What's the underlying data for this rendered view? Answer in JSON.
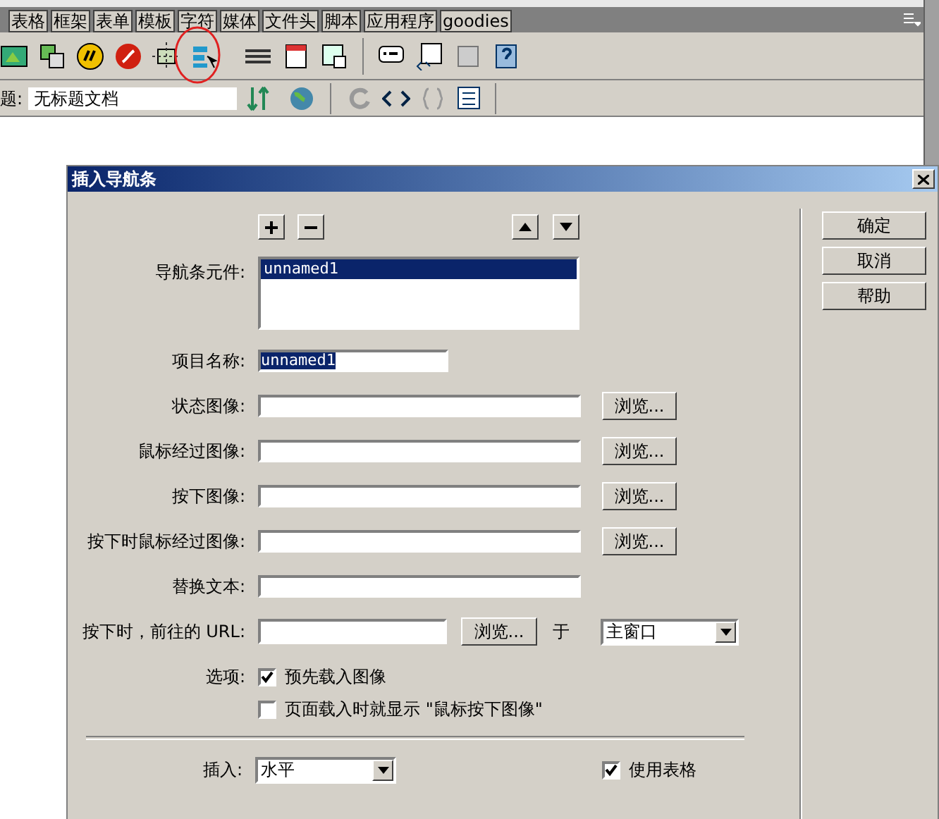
{
  "insert_bar": {
    "tabs": [
      {
        "label": "表格"
      },
      {
        "label": "框架"
      },
      {
        "label": "表单"
      },
      {
        "label": "模板"
      },
      {
        "label": "字符"
      },
      {
        "label": "媒体"
      },
      {
        "label": "文件头"
      },
      {
        "label": "脚本"
      },
      {
        "label": "应用程序"
      },
      {
        "label": "goodies"
      }
    ]
  },
  "document_toolbar": {
    "title_label": "题:",
    "title_value": "无标题文档"
  },
  "dialog": {
    "title": "插入导航条",
    "elements": {
      "label": "导航条元件:",
      "items": [
        {
          "label": "unnamed1",
          "selected": true
        }
      ]
    },
    "item_name": {
      "label": "项目名称:",
      "value": "unnamed1",
      "text_selected": true
    },
    "image_fields": [
      {
        "label": "状态图像:",
        "browse": "浏览..."
      },
      {
        "label": "鼠标经过图像:",
        "browse": "浏览..."
      },
      {
        "label": "按下图像:",
        "browse": "浏览..."
      },
      {
        "label": "按下时鼠标经过图像:",
        "browse": "浏览..."
      }
    ],
    "alt_text": {
      "label": "替换文本:"
    },
    "url": {
      "label": "按下时，前往的 URL:",
      "browse": "浏览...",
      "in_label": "于",
      "target": "主窗口"
    },
    "options": {
      "label": "选项:",
      "checkboxes": [
        {
          "label": "预先载入图像",
          "checked": true
        },
        {
          "label": "页面载入时就显示 \"鼠标按下图像\"",
          "checked": false
        }
      ]
    },
    "insert": {
      "label": "插入:",
      "value": "水平"
    },
    "use_table": {
      "label": "使用表格",
      "checked": true
    },
    "buttons": [
      "确定",
      "取消",
      "帮助"
    ]
  }
}
